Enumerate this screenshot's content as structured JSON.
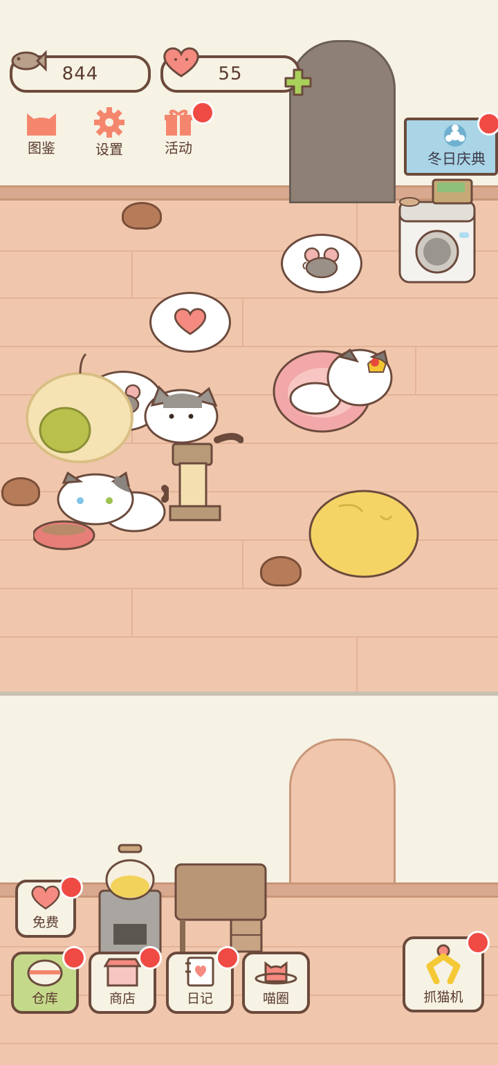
{
  "hud": {
    "fish_count": "844",
    "heart_count": "55"
  },
  "top_menu": [
    {
      "label": "图鉴",
      "icon": "cat-head-icon"
    },
    {
      "label": "设置",
      "icon": "gear-icon"
    },
    {
      "label": "活动",
      "icon": "gift-icon"
    }
  ],
  "event_banner": {
    "label": "冬日庆典"
  },
  "bottom_menu": {
    "free": "免费",
    "storage": "仓库",
    "shop": "商店",
    "diary": "日记",
    "meow_circle": "喵圈",
    "claw_machine": "抓猫机"
  },
  "colors": {
    "accent_red": "#f04a45",
    "outline": "#6b4a3c",
    "floor": "#f0c7ad",
    "wall": "#f6f2e4",
    "plus_green": "#a8d05a"
  }
}
